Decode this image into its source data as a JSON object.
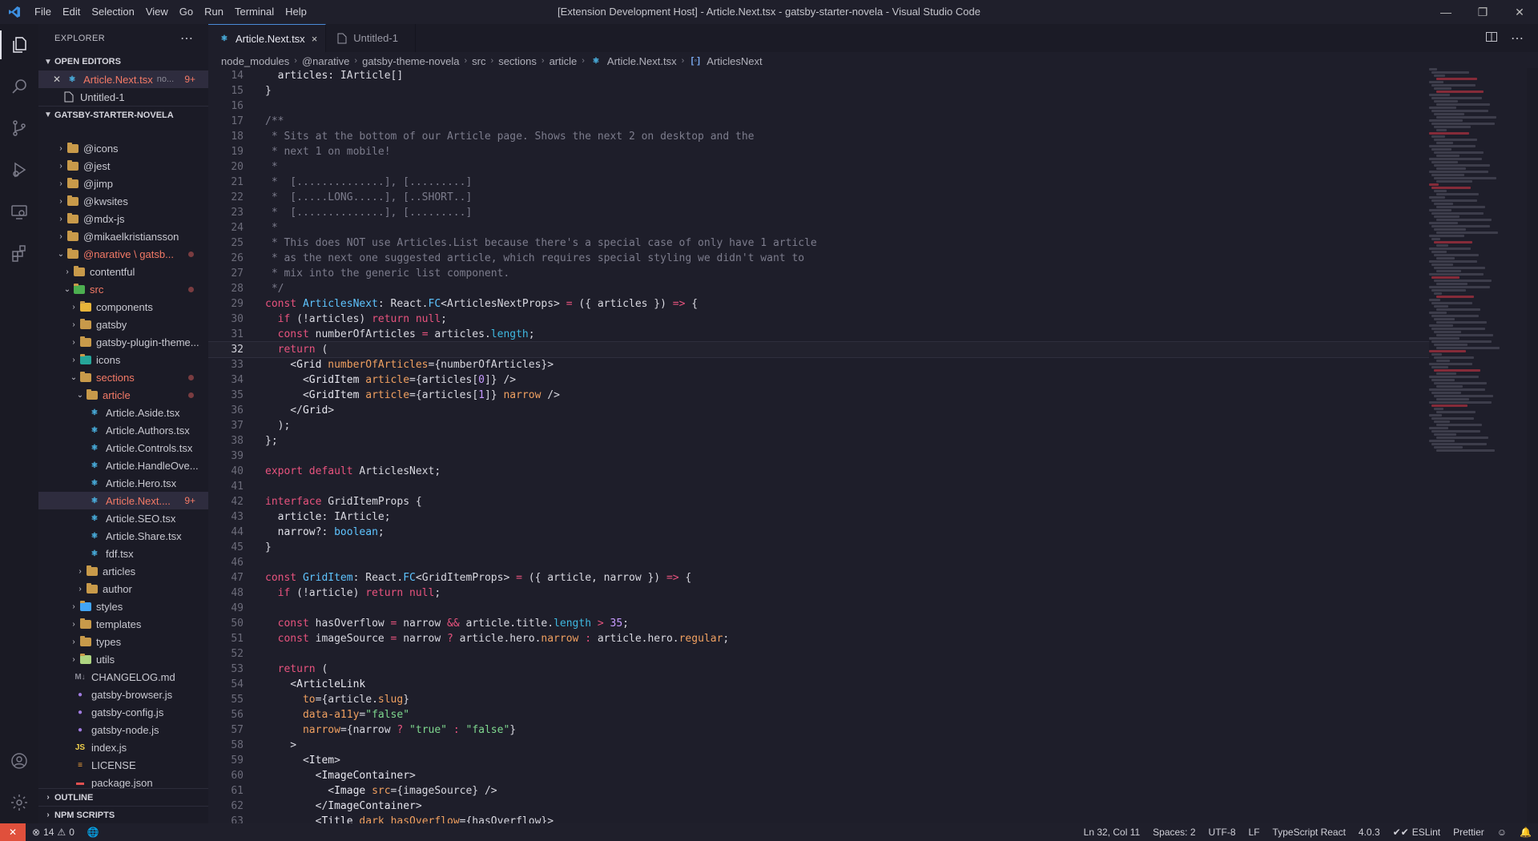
{
  "window": {
    "title": "[Extension Development Host] - Article.Next.tsx - gatsby-starter-novela - Visual Studio Code",
    "menu": [
      "File",
      "Edit",
      "Selection",
      "View",
      "Go",
      "Run",
      "Terminal",
      "Help"
    ]
  },
  "colors": {
    "accent": "#4a8ad8",
    "modified": "#f47a66",
    "remote": "#e0503c"
  },
  "sidebar": {
    "title": "EXPLORER",
    "open_editors_title": "OPEN EDITORS",
    "open_editors": [
      {
        "name": "Article.Next.tsx",
        "hint": "no...",
        "badge": "9+"
      },
      {
        "name": "Untitled-1"
      }
    ],
    "project_title": "GATSBY-STARTER-NOVELA",
    "tree": [
      {
        "label": "@icons"
      },
      {
        "label": "@jest"
      },
      {
        "label": "@jimp"
      },
      {
        "label": "@kwsites"
      },
      {
        "label": "@mdx-js"
      },
      {
        "label": "@mikaelkristiansson"
      },
      {
        "label": "@narative",
        "label2": "gatsb..."
      },
      {
        "label": "contentful"
      },
      {
        "label": "src"
      },
      {
        "label": "components"
      },
      {
        "label": "gatsby"
      },
      {
        "label": "gatsby-plugin-theme..."
      },
      {
        "label": "icons"
      },
      {
        "label": "sections"
      },
      {
        "label": "article"
      },
      {
        "label": "Article.Aside.tsx"
      },
      {
        "label": "Article.Authors.tsx"
      },
      {
        "label": "Article.Controls.tsx"
      },
      {
        "label": "Article.HandleOve..."
      },
      {
        "label": "Article.Hero.tsx"
      },
      {
        "label": "Article.Next....",
        "badge": "9+"
      },
      {
        "label": "Article.SEO.tsx"
      },
      {
        "label": "Article.Share.tsx"
      },
      {
        "label": "fdf.tsx"
      },
      {
        "label": "articles"
      },
      {
        "label": "author"
      },
      {
        "label": "styles"
      },
      {
        "label": "templates"
      },
      {
        "label": "types"
      },
      {
        "label": "utils"
      },
      {
        "label": "CHANGELOG.md"
      },
      {
        "label": "gatsby-browser.js"
      },
      {
        "label": "gatsby-config.js"
      },
      {
        "label": "gatsby-node.js"
      },
      {
        "label": "index.js"
      },
      {
        "label": "LICENSE"
      },
      {
        "label": "package.json"
      }
    ],
    "outline_title": "OUTLINE",
    "npm_title": "NPM SCRIPTS"
  },
  "tabs": [
    {
      "label": "Article.Next.tsx",
      "close": "×"
    },
    {
      "label": "Untitled-1"
    }
  ],
  "breadcrumbs": [
    "node_modules",
    "@narative",
    "gatsby-theme-novela",
    "src",
    "sections",
    "article",
    "Article.Next.tsx",
    "ArticlesNext"
  ],
  "editor": {
    "current_line": 32,
    "lines": [
      {
        "n": "14",
        "t": [
          [
            "pl",
            "  "
          ],
          [
            "prop",
            "articles"
          ],
          [
            "pl",
            ": IArticle[]"
          ]
        ]
      },
      {
        "n": "15",
        "t": [
          [
            "pl",
            "}"
          ]
        ]
      },
      {
        "n": "16",
        "t": []
      },
      {
        "n": "17",
        "t": [
          [
            "com",
            "/**"
          ]
        ]
      },
      {
        "n": "18",
        "t": [
          [
            "com",
            " * Sits at the bottom of our Article page. Shows the next 2 on desktop and the"
          ]
        ]
      },
      {
        "n": "19",
        "t": [
          [
            "com",
            " * next 1 on mobile!"
          ]
        ]
      },
      {
        "n": "20",
        "t": [
          [
            "com",
            " *"
          ]
        ]
      },
      {
        "n": "21",
        "t": [
          [
            "com",
            " *  [..............], [.........]"
          ]
        ]
      },
      {
        "n": "22",
        "t": [
          [
            "com",
            " *  [.....LONG.....], [..SHORT..]"
          ]
        ]
      },
      {
        "n": "23",
        "t": [
          [
            "com",
            " *  [..............], [.........]"
          ]
        ]
      },
      {
        "n": "24",
        "t": [
          [
            "com",
            " *"
          ]
        ]
      },
      {
        "n": "25",
        "t": [
          [
            "com",
            " * This does NOT use Articles.List because there's a special case of only have 1 article"
          ]
        ]
      },
      {
        "n": "26",
        "t": [
          [
            "com",
            " * as the next one suggested article, which requires special styling we didn't want to"
          ]
        ]
      },
      {
        "n": "27",
        "t": [
          [
            "com",
            " * mix into the generic list component."
          ]
        ]
      },
      {
        "n": "28",
        "t": [
          [
            "com",
            " */"
          ]
        ]
      },
      {
        "n": "29",
        "t": [
          [
            "kw",
            "const "
          ],
          [
            "type",
            "ArticlesNext"
          ],
          [
            "pl",
            ": React."
          ],
          [
            "type",
            "FC"
          ],
          [
            "pl",
            "<ArticlesNextProps> "
          ],
          [
            "op",
            "="
          ],
          [
            "pl",
            " ({ articles }) "
          ],
          [
            "op",
            "=>"
          ],
          [
            "pl",
            " {"
          ]
        ]
      },
      {
        "n": "30",
        "t": [
          [
            "pl",
            "  "
          ],
          [
            "kw",
            "if"
          ],
          [
            "pl",
            " (!articles) "
          ],
          [
            "kw",
            "return"
          ],
          [
            "pl",
            " "
          ],
          [
            "kw",
            "null"
          ],
          [
            "pl",
            ";"
          ]
        ]
      },
      {
        "n": "31",
        "t": [
          [
            "pl",
            "  "
          ],
          [
            "kw",
            "const"
          ],
          [
            "pl",
            " numberOfArticles "
          ],
          [
            "op",
            "="
          ],
          [
            "pl",
            " articles."
          ],
          [
            "fn",
            "length"
          ],
          [
            "pl",
            ";"
          ]
        ]
      },
      {
        "n": "32",
        "t": [
          [
            "pl",
            "  "
          ],
          [
            "kw",
            "return"
          ],
          [
            "pl",
            " ("
          ]
        ]
      },
      {
        "n": "33",
        "t": [
          [
            "pl",
            "    <"
          ],
          [
            "tag",
            "Grid"
          ],
          [
            "pl",
            " "
          ],
          [
            "attr",
            "numberOfArticles"
          ],
          [
            "pl",
            "={numberOfArticles}>"
          ]
        ]
      },
      {
        "n": "34",
        "t": [
          [
            "pl",
            "      <"
          ],
          [
            "tag",
            "GridItem"
          ],
          [
            "pl",
            " "
          ],
          [
            "attr",
            "article"
          ],
          [
            "pl",
            "={articles["
          ],
          [
            "num",
            "0"
          ],
          [
            "pl",
            "]} />"
          ]
        ]
      },
      {
        "n": "35",
        "t": [
          [
            "pl",
            "      <"
          ],
          [
            "tag",
            "GridItem"
          ],
          [
            "pl",
            " "
          ],
          [
            "attr",
            "article"
          ],
          [
            "pl",
            "={articles["
          ],
          [
            "num",
            "1"
          ],
          [
            "pl",
            "]} "
          ],
          [
            "attr",
            "narrow"
          ],
          [
            "pl",
            " />"
          ]
        ]
      },
      {
        "n": "36",
        "t": [
          [
            "pl",
            "    </"
          ],
          [
            "tag",
            "Grid"
          ],
          [
            "pl",
            ">"
          ]
        ]
      },
      {
        "n": "37",
        "t": [
          [
            "pl",
            "  );"
          ]
        ]
      },
      {
        "n": "38",
        "t": [
          [
            "pl",
            "};"
          ]
        ]
      },
      {
        "n": "39",
        "t": []
      },
      {
        "n": "40",
        "t": [
          [
            "kw",
            "export default"
          ],
          [
            "pl",
            " ArticlesNext;"
          ]
        ]
      },
      {
        "n": "41",
        "t": []
      },
      {
        "n": "42",
        "t": [
          [
            "kw",
            "interface"
          ],
          [
            "pl",
            " GridItemProps {"
          ]
        ]
      },
      {
        "n": "43",
        "t": [
          [
            "pl",
            "  "
          ],
          [
            "prop",
            "article"
          ],
          [
            "pl",
            ": IArticle;"
          ]
        ]
      },
      {
        "n": "44",
        "t": [
          [
            "pl",
            "  "
          ],
          [
            "prop",
            "narrow"
          ],
          [
            "pl",
            "?: "
          ],
          [
            "type",
            "boolean"
          ],
          [
            "pl",
            ";"
          ]
        ]
      },
      {
        "n": "45",
        "t": [
          [
            "pl",
            "}"
          ]
        ]
      },
      {
        "n": "46",
        "t": []
      },
      {
        "n": "47",
        "t": [
          [
            "kw",
            "const "
          ],
          [
            "type",
            "GridItem"
          ],
          [
            "pl",
            ": React."
          ],
          [
            "type",
            "FC"
          ],
          [
            "pl",
            "<GridItemProps> "
          ],
          [
            "op",
            "="
          ],
          [
            "pl",
            " ({ article, narrow }) "
          ],
          [
            "op",
            "=>"
          ],
          [
            "pl",
            " {"
          ]
        ]
      },
      {
        "n": "48",
        "t": [
          [
            "pl",
            "  "
          ],
          [
            "kw",
            "if"
          ],
          [
            "pl",
            " (!article) "
          ],
          [
            "kw",
            "return"
          ],
          [
            "pl",
            " "
          ],
          [
            "kw",
            "null"
          ],
          [
            "pl",
            ";"
          ]
        ]
      },
      {
        "n": "49",
        "t": []
      },
      {
        "n": "50",
        "t": [
          [
            "pl",
            "  "
          ],
          [
            "kw",
            "const"
          ],
          [
            "pl",
            " hasOverflow "
          ],
          [
            "op",
            "="
          ],
          [
            "pl",
            " narrow "
          ],
          [
            "op",
            "&&"
          ],
          [
            "pl",
            " article.title."
          ],
          [
            "fn",
            "length"
          ],
          [
            "pl",
            " "
          ],
          [
            "op",
            ">"
          ],
          [
            "pl",
            " "
          ],
          [
            "num",
            "35"
          ],
          [
            "pl",
            ";"
          ]
        ]
      },
      {
        "n": "51",
        "t": [
          [
            "pl",
            "  "
          ],
          [
            "kw",
            "const"
          ],
          [
            "pl",
            " imageSource "
          ],
          [
            "op",
            "="
          ],
          [
            "pl",
            " narrow "
          ],
          [
            "op",
            "?"
          ],
          [
            "pl",
            " article.hero."
          ],
          [
            "attr",
            "narrow"
          ],
          [
            "pl",
            " "
          ],
          [
            "op",
            ":"
          ],
          [
            "pl",
            " article.hero."
          ],
          [
            "attr",
            "regular"
          ],
          [
            "pl",
            ";"
          ]
        ]
      },
      {
        "n": "52",
        "t": []
      },
      {
        "n": "53",
        "t": [
          [
            "pl",
            "  "
          ],
          [
            "kw",
            "return"
          ],
          [
            "pl",
            " ("
          ]
        ]
      },
      {
        "n": "54",
        "t": [
          [
            "pl",
            "    <"
          ],
          [
            "tag",
            "ArticleLink"
          ]
        ]
      },
      {
        "n": "55",
        "t": [
          [
            "pl",
            "      "
          ],
          [
            "attr",
            "to"
          ],
          [
            "pl",
            "={article."
          ],
          [
            "attr",
            "slug"
          ],
          [
            "pl",
            "}"
          ]
        ]
      },
      {
        "n": "56",
        "t": [
          [
            "pl",
            "      "
          ],
          [
            "attr",
            "data-a11y"
          ],
          [
            "pl",
            "="
          ],
          [
            "str",
            "\"false\""
          ]
        ]
      },
      {
        "n": "57",
        "t": [
          [
            "pl",
            "      "
          ],
          [
            "attr",
            "narrow"
          ],
          [
            "pl",
            "={narrow "
          ],
          [
            "op",
            "?"
          ],
          [
            "pl",
            " "
          ],
          [
            "str",
            "\"true\""
          ],
          [
            "pl",
            " "
          ],
          [
            "op",
            ":"
          ],
          [
            "pl",
            " "
          ],
          [
            "str",
            "\"false\""
          ],
          [
            "pl",
            "}"
          ]
        ]
      },
      {
        "n": "58",
        "t": [
          [
            "pl",
            "    >"
          ]
        ]
      },
      {
        "n": "59",
        "t": [
          [
            "pl",
            "      <"
          ],
          [
            "tag",
            "Item"
          ],
          [
            "pl",
            ">"
          ]
        ]
      },
      {
        "n": "60",
        "t": [
          [
            "pl",
            "        <"
          ],
          [
            "tag",
            "ImageContainer"
          ],
          [
            "pl",
            ">"
          ]
        ]
      },
      {
        "n": "61",
        "t": [
          [
            "pl",
            "          <"
          ],
          [
            "tag",
            "Image"
          ],
          [
            "pl",
            " "
          ],
          [
            "attr",
            "src"
          ],
          [
            "pl",
            "={imageSource} />"
          ]
        ]
      },
      {
        "n": "62",
        "t": [
          [
            "pl",
            "        </"
          ],
          [
            "tag",
            "ImageContainer"
          ],
          [
            "pl",
            ">"
          ]
        ]
      },
      {
        "n": "63",
        "t": [
          [
            "pl",
            "        <"
          ],
          [
            "tag",
            "Title"
          ],
          [
            "pl",
            " "
          ],
          [
            "attr",
            "dark"
          ],
          [
            "pl",
            " "
          ],
          [
            "attr",
            "hasOverflow"
          ],
          [
            "pl",
            "={hasOverflow}>"
          ]
        ]
      }
    ]
  },
  "status": {
    "errors": "14",
    "warnings": "0",
    "position": "Ln 32, Col 11",
    "spaces": "Spaces: 2",
    "encoding": "UTF-8",
    "eol": "LF",
    "language": "TypeScript React",
    "version": "4.0.3",
    "eslint": "ESLint",
    "prettier": "Prettier"
  }
}
